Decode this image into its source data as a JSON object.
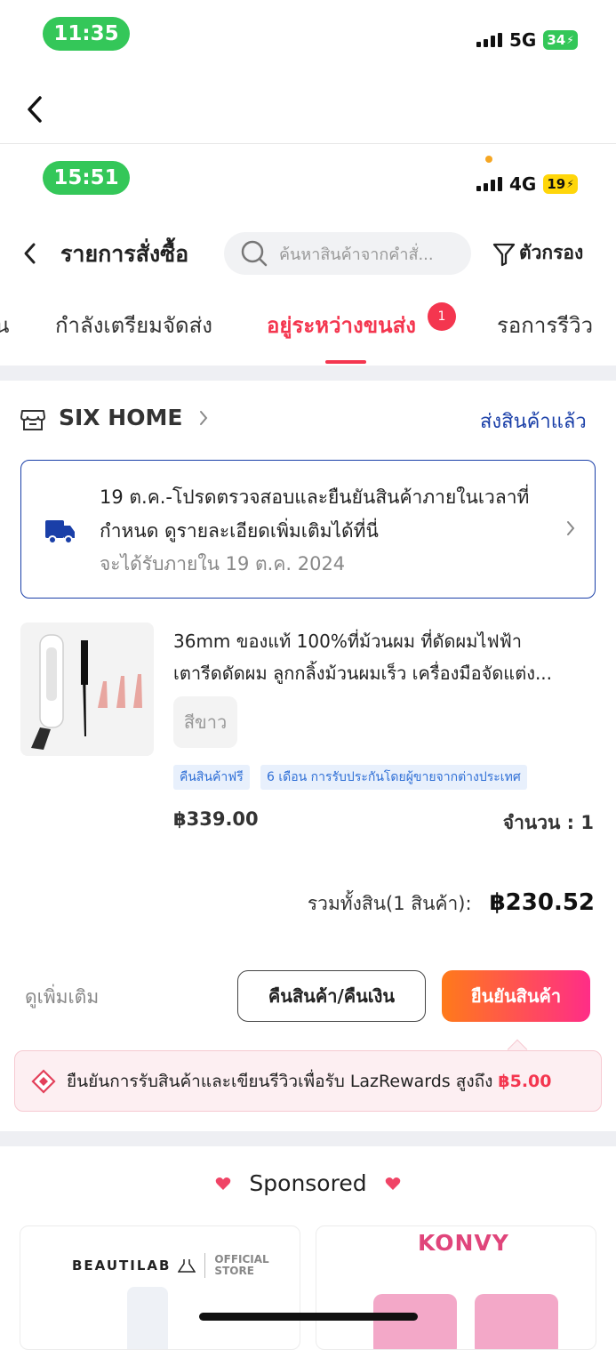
{
  "outer_status": {
    "time": "11:35",
    "network": "5G",
    "battery": "34"
  },
  "inner_status": {
    "time": "15:51",
    "network": "4G",
    "battery": "19"
  },
  "header": {
    "title": "รายการสั่งซื้อ",
    "search_placeholder": "ค้นหาสินค้าจากคำสั่...",
    "filter_label": "ตัวกรอง"
  },
  "tabs": [
    {
      "label": "น",
      "active": false
    },
    {
      "label": "กำลังเตรียมจัดส่ง",
      "active": false
    },
    {
      "label": "อยู่ระหว่างขนส่ง",
      "active": true,
      "badge": "1"
    },
    {
      "label": "รอการรีวิว",
      "active": false
    }
  ],
  "shop": {
    "name": "SIX HOME",
    "status": "ส่งสินค้าแล้ว"
  },
  "delivery": {
    "line1": "19 ต.ค.-โปรดตรวจสอบและยืนยันสินค้าภายในเวลาที่",
    "line2": "กำหนด ดูรายละเอียดเพิ่มเติมได้ที่นี่",
    "eta": "จะได้รับภายใน 19 ต.ค. 2024"
  },
  "product": {
    "title_line1": "36mm ของแท้ 100%ที่ม้วนผม ที่ดัดผมไฟฟ้า",
    "title_line2": "เตารีดดัดผม ลูกกลิ้งม้วนผมเร็ว เครื่องมือจัดแต่ง...",
    "variant": "สีขาว",
    "tags": [
      "คืนสินค้าฟรี",
      "6 เดือน การรับประกันโดยผู้ขายจากต่างประเทศ"
    ],
    "price": "฿339.00",
    "quantity_label": "จำนวน : 1"
  },
  "total": {
    "label": "รวมทั้งสิน(1 สินค้า):",
    "amount": "฿230.52"
  },
  "actions": {
    "more": "ดูเพิ่มเติม",
    "refund": "คืนสินค้า/คืนเงิน",
    "confirm": "ยืนยันสินค้า"
  },
  "reward": {
    "text": "ยืนยันการรับสินค้าและเขียนรีวิวเพื่อรับ LazRewards สูงถึง",
    "amount": "฿5.00"
  },
  "sponsored": {
    "title": "Sponsored",
    "card1": {
      "brand": "BEAUTILAB",
      "store_line1": "OFFICIAL",
      "store_line2": "STORE"
    },
    "card2": {
      "brand": "KONVY"
    }
  },
  "colors": {
    "accent": "#f4364f",
    "link_blue": "#1a3fa8",
    "confirm_start": "#ff7a1a",
    "confirm_end": "#ff2d87",
    "status_green": "#34c759"
  }
}
